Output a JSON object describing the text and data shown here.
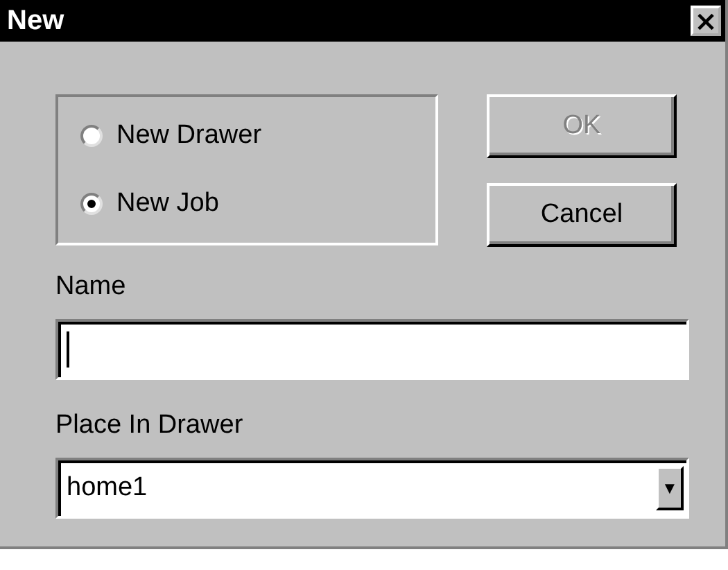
{
  "window": {
    "title": "New",
    "close": "×"
  },
  "options": [
    {
      "label": "New Drawer",
      "selected": false
    },
    {
      "label": "New Job",
      "selected": true
    }
  ],
  "buttons": [
    {
      "label": "OK",
      "disabled": true
    },
    {
      "label": "Cancel",
      "disabled": false
    }
  ],
  "name_field": {
    "label": "Name"
  },
  "drawer_field": {
    "label": "Place In Drawer",
    "value": "home1",
    "arrow": "▼"
  }
}
